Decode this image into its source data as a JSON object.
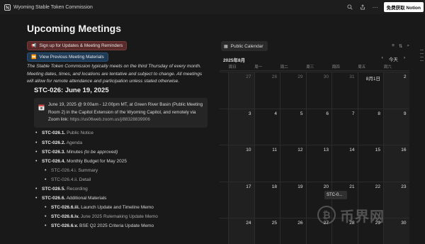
{
  "window": {
    "title": "Wyoming Stable Token Commission",
    "notion_button": "免费获取 Notion"
  },
  "page": {
    "title": "Upcoming Meetings",
    "signup_button": "Sign up for Updates & Meeting Reminders",
    "previous_button": "View Previous Meeting Materials",
    "intro": "The Stable Token Commission typically meets on the third Thursday of every month. Meeting dates, times, and locations are tentative and subject to change. All meetings will allow for remote attendance and participation unless stated otherwise.",
    "section_title": "STC-026: June 19, 2025",
    "callout_main": "June 19, 2025 @ 9:00am - 12:00pm MT, at Green River Basin (Public Meeting Room 2) in the Capitol Extension of the Wyoming Capitol, and remotely via Zoom link: ",
    "callout_link": "https://us06web.zoom.us/j/88328839906",
    "agenda": [
      {
        "code": "STC-026.1.",
        "label": "Public Notice"
      },
      {
        "code": "STC-026.2.",
        "label": "Agenda"
      },
      {
        "code": "STC-026.3.",
        "label": "Minutes ",
        "note": "(to be approved)"
      },
      {
        "code": "STC-026.4.",
        "label": "Monthly Budget for May 2025"
      },
      {
        "code": "STC-026.4.i.",
        "label": "Summary"
      },
      {
        "code": "STC-026.4.ii.",
        "label": "Detail"
      },
      {
        "code": "STC-026.5.",
        "label": "Recording"
      },
      {
        "code": "STC-026.6.",
        "label": "Additional Materials"
      },
      {
        "code": "STC-026.6.iii.",
        "label": "Launch Update and Timeline Memo"
      },
      {
        "code": "STC-026.6.iv.",
        "label": "June 2025 Rulemaking Update Memo"
      },
      {
        "code": "STC-026.6.v.",
        "label": "BSE Q2 2025 Criteria Update Memo"
      }
    ]
  },
  "calendar": {
    "view_button": "Public Calendar",
    "month": "2025年8月",
    "today": "今天",
    "weekdays": [
      "周日",
      "周一",
      "周二",
      "周三",
      "周四",
      "周五",
      "周六"
    ],
    "weeks": [
      [
        "27",
        "28",
        "29",
        "30",
        "31",
        "8月1日",
        "2"
      ],
      [
        "3",
        "4",
        "5",
        "6",
        "7",
        "8",
        "9"
      ],
      [
        "10",
        "11",
        "12",
        "13",
        "14",
        "15",
        "16"
      ],
      [
        "17",
        "18",
        "19",
        "20",
        "21",
        "22",
        "23"
      ],
      [
        "24",
        "25",
        "26",
        "27",
        "28",
        "29",
        "30"
      ]
    ],
    "event": "STC-0...",
    "colors": {
      "background": "#191919",
      "grid": "#2c2c2c",
      "weekend": "#202020"
    }
  },
  "watermark": {
    "text": "币界网"
  }
}
